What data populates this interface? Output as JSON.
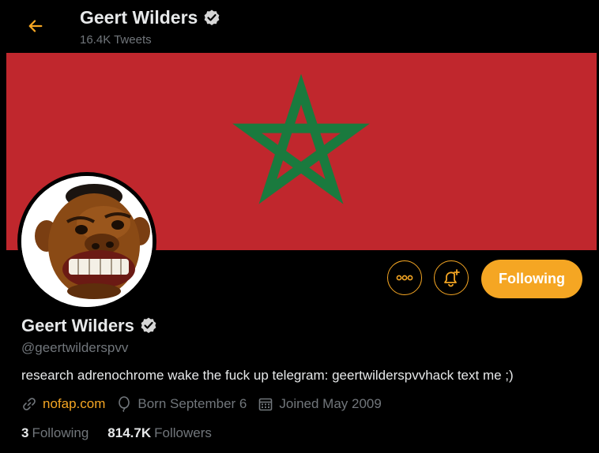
{
  "header": {
    "back_icon": "arrow-left-icon",
    "name": "Geert Wilders",
    "tweet_count": "16.4K Tweets"
  },
  "profile": {
    "name": "Geert Wilders",
    "handle": "@geertwilderspvv",
    "bio": "research adrenochrome wake the fuck up telegram: geertwilderspvvhack text me ;)",
    "website": "nofap.com",
    "birthday": "Born September 6",
    "joined": "Joined May 2009",
    "following_count": "3",
    "following_label": "Following",
    "followers_count": "814.7K",
    "followers_label": "Followers"
  },
  "actions": {
    "more_icon": "more-icon",
    "notify_icon": "bell-plus-icon",
    "follow_label": "Following"
  },
  "colors": {
    "accent": "#f5a623",
    "banner_red": "#c0272d",
    "banner_star": "#1a7a3e",
    "background": "#000000",
    "muted_text": "#71767b"
  }
}
